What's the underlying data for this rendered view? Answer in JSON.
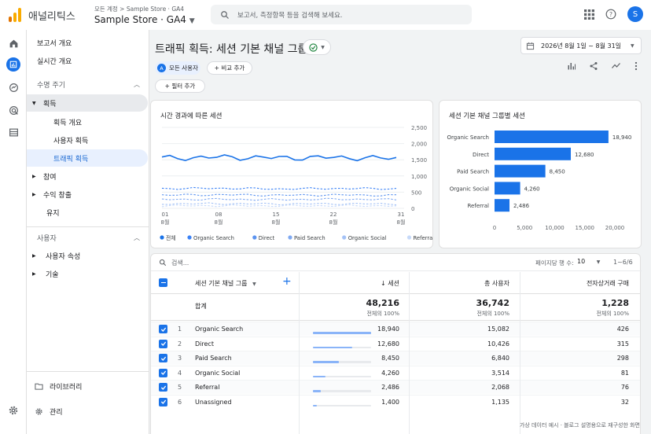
{
  "app": {
    "brand": "애널리틱스",
    "breadcrumb": "모든 계정 > Sample Store · GA4",
    "property": "Sample Store · GA4",
    "search_placeholder": "보고서, 측정항목 등을 검색해 보세요.",
    "avatar_letter": "S"
  },
  "rail": [
    "home-icon",
    "reports-icon",
    "explore-icon",
    "advertising-icon",
    "configure-icon",
    "settings-icon"
  ],
  "nav": {
    "reports_overview": "보고서 개요",
    "realtime": "실시간 개요",
    "lifecycle": "수명 주기",
    "acquisition": "획득",
    "acq_overview": "획득 개요",
    "user_acq": "사용자 획득",
    "traffic_acq": "트래픽 획득",
    "engagement": "참여",
    "monetization": "수익 창출",
    "retention": "유지",
    "user": "사용자",
    "user_attrs": "사용자 속성",
    "tech": "기술",
    "library": "라이브러리",
    "admin": "관리"
  },
  "header": {
    "title": "트래픽 획득: 세션 기본 채널 그룹",
    "date_range": "2026년 8월 1일 ~ 8월 31일",
    "segment_letter": "A",
    "segment": "모든 사용자",
    "compare": "+ 비교 추가",
    "filter": "+ 필터 추가"
  },
  "line_chart": {
    "title": "시간 경과에 따른 세션",
    "y_ticks": [
      "2,500",
      "2,000",
      "1,500",
      "1,000",
      "500",
      "0"
    ],
    "x_ticks": [
      {
        "d": "01",
        "m": "8월"
      },
      {
        "d": "08",
        "m": "8월"
      },
      {
        "d": "15",
        "m": "8월"
      },
      {
        "d": "22",
        "m": "8월"
      },
      {
        "d": "31",
        "m": "8월"
      }
    ],
    "legend": [
      {
        "label": "전체",
        "color": "#1a73e8"
      },
      {
        "label": "Organic Search",
        "color": "#3b82f6"
      },
      {
        "label": "Direct",
        "color": "#5c94f0"
      },
      {
        "label": "Paid Search",
        "color": "#7fa9f2"
      },
      {
        "label": "Organic Social",
        "color": "#a4c2f6"
      },
      {
        "label": "Referral",
        "color": "#c6d9f9"
      }
    ]
  },
  "bar_chart": {
    "title": "세션 기본 채널 그룹별 세션",
    "x_ticks": [
      "0",
      "5,000",
      "10,000",
      "15,000",
      "20,000"
    ],
    "bars": [
      {
        "label": "Organic Search",
        "value_label": "18,940"
      },
      {
        "label": "Direct",
        "value_label": "12,680"
      },
      {
        "label": "Paid Search",
        "value_label": "8,450"
      },
      {
        "label": "Organic Social",
        "value_label": "4,260"
      },
      {
        "label": "Referral",
        "value_label": "2,486"
      }
    ]
  },
  "chart_data": [
    {
      "type": "line",
      "title": "시간 경과에 따른 세션",
      "x": [
        "8월 01",
        "8월 08",
        "8월 15",
        "8월 22",
        "8월 31"
      ],
      "ylim": [
        0,
        2500
      ],
      "grid": true,
      "legend_position": "bottom",
      "series": [
        {
          "name": "전체",
          "values": [
            1550,
            1580,
            1560,
            1570,
            1540
          ]
        },
        {
          "name": "Organic Search",
          "values": [
            610,
            620,
            600,
            615,
            605
          ]
        },
        {
          "name": "Direct",
          "values": [
            410,
            420,
            405,
            415,
            400
          ]
        },
        {
          "name": "Paid Search",
          "values": [
            275,
            280,
            270,
            285,
            270
          ]
        },
        {
          "name": "Organic Social",
          "values": [
            140,
            145,
            135,
            140,
            138
          ]
        },
        {
          "name": "Referral",
          "values": [
            80,
            82,
            78,
            80,
            79
          ]
        }
      ]
    },
    {
      "type": "bar",
      "orientation": "horizontal",
      "title": "세션 기본 채널 그룹별 세션",
      "categories": [
        "Organic Search",
        "Direct",
        "Paid Search",
        "Organic Social",
        "Referral"
      ],
      "values": [
        18940,
        12680,
        8450,
        4260,
        2486
      ],
      "xlim": [
        0,
        20000
      ]
    }
  ],
  "table": {
    "search_placeholder": "검색...",
    "rows_per_page_label": "페이지당 행 수:",
    "rows_per_page": "10",
    "range": "1~6/6",
    "dim_header": "세션 기본 채널 그룹",
    "cols": [
      "↓ 세션",
      "총 사용자",
      "전자상거래 구매"
    ],
    "total_label": "합계",
    "totals": [
      "48,216",
      "36,742",
      "1,228"
    ],
    "totals_sub": [
      "전체의 100%",
      "전체의 100%",
      "전체의 100%"
    ],
    "rows": [
      {
        "n": "1",
        "name": "Organic Search",
        "sessions": "18,940",
        "users": "15,082",
        "purchases": "426",
        "share": 1.0
      },
      {
        "n": "2",
        "name": "Direct",
        "sessions": "12,680",
        "users": "10,426",
        "purchases": "315",
        "share": 0.67
      },
      {
        "n": "3",
        "name": "Paid Search",
        "sessions": "8,450",
        "users": "6,840",
        "purchases": "298",
        "share": 0.45
      },
      {
        "n": "4",
        "name": "Organic Social",
        "sessions": "4,260",
        "users": "3,514",
        "purchases": "81",
        "share": 0.22
      },
      {
        "n": "5",
        "name": "Referral",
        "sessions": "2,486",
        "users": "2,068",
        "purchases": "76",
        "share": 0.13
      },
      {
        "n": "6",
        "name": "Unassigned",
        "sessions": "1,400",
        "users": "1,135",
        "purchases": "32",
        "share": 0.07
      }
    ]
  },
  "footer": "가상 데이터 예시 · 블로그 설명용으로 재구성한 화면"
}
